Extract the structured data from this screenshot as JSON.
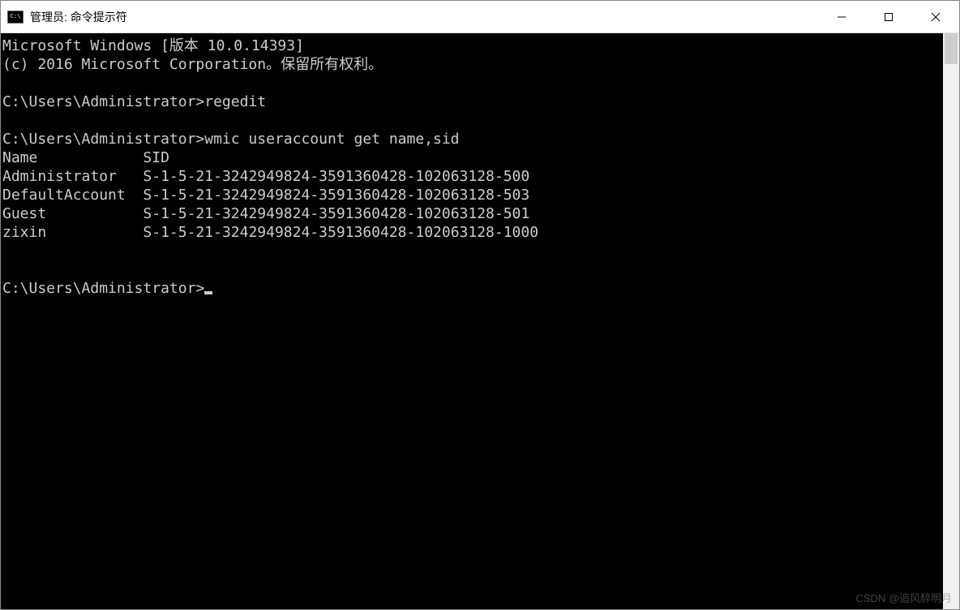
{
  "window": {
    "title": "管理员: 命令提示符",
    "icon_label": "C:\\"
  },
  "terminal": {
    "banner_line1": "Microsoft Windows [版本 10.0.14393]",
    "banner_line2": "(c) 2016 Microsoft Corporation。保留所有权利。",
    "prompt1": "C:\\Users\\Administrator>",
    "command1": "regedit",
    "prompt2": "C:\\Users\\Administrator>",
    "command2": "wmic useraccount get name,sid",
    "header_name": "Name",
    "header_sid": "SID",
    "accounts": [
      {
        "name": "Administrator",
        "sid": "S-1-5-21-3242949824-3591360428-102063128-500"
      },
      {
        "name": "DefaultAccount",
        "sid": "S-1-5-21-3242949824-3591360428-102063128-503"
      },
      {
        "name": "Guest",
        "sid": "S-1-5-21-3242949824-3591360428-102063128-501"
      },
      {
        "name": "zixin",
        "sid": "S-1-5-21-3242949824-3591360428-102063128-1000"
      }
    ],
    "prompt3": "C:\\Users\\Administrator>"
  },
  "watermark": "CSDN @追风醉明月"
}
